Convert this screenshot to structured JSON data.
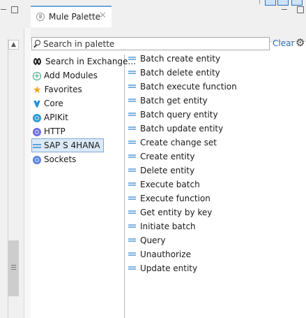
{
  "palette": {
    "tab_title": "Mule Palette",
    "search_placeholder": "Search in palette",
    "clear_label": "Clear"
  },
  "categories": [
    {
      "label": "Search in Exchange...",
      "icon": "exchange-icon"
    },
    {
      "label": "Add Modules",
      "icon": "add-circle-icon"
    },
    {
      "label": "Favorites",
      "icon": "star-icon"
    },
    {
      "label": "Core",
      "icon": "core-icon"
    },
    {
      "label": "APIKit",
      "icon": "apikit-icon"
    },
    {
      "label": "HTTP",
      "icon": "http-icon"
    },
    {
      "label": "SAP S 4HANA",
      "icon": "sap-connector-icon",
      "selected": true
    },
    {
      "label": "Sockets",
      "icon": "sockets-icon"
    }
  ],
  "operations": [
    "Batch create entity",
    "Batch delete entity",
    "Batch execute function",
    "Batch get entity",
    "Batch query entity",
    "Batch update entity",
    "Create change set",
    "Create entity",
    "Delete entity",
    "Execute batch",
    "Execute function",
    "Get entity by key",
    "Initiate batch",
    "Query",
    "Unauthorize",
    "Update entity"
  ],
  "colors": {
    "accent": "#2a6db8",
    "selected_bg": "#dbe9f8",
    "op_icon": "#7fb3e0"
  }
}
